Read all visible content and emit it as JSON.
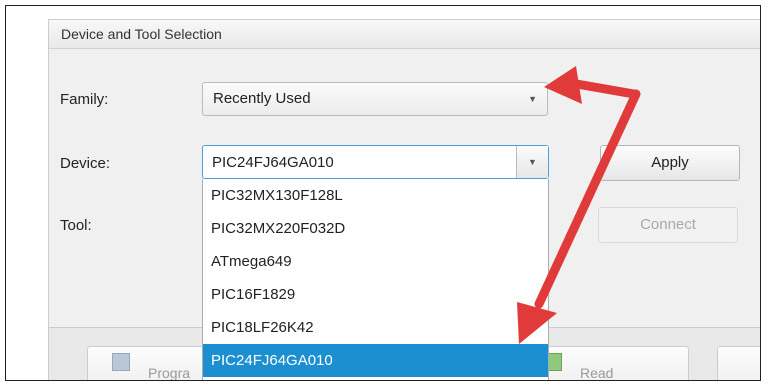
{
  "panel": {
    "title": "Device and Tool Selection"
  },
  "form": {
    "family_label": "Family:",
    "family_value": "Recently Used",
    "device_label": "Device:",
    "device_value": "PIC24FJ64GA010",
    "tool_label": "Tool:"
  },
  "buttons": {
    "apply": "Apply",
    "connect": "Connect",
    "program": "Progra",
    "read": "Read"
  },
  "dropdown": {
    "items": [
      "PIC32MX130F128L",
      "PIC32MX220F032D",
      "ATmega649",
      "PIC16F1829",
      "PIC18LF26K42",
      "PIC24FJ64GA010"
    ],
    "selected_index": 5
  },
  "colors": {
    "annotation_arrow": "#e03a3a",
    "selection": "#1c8fd0",
    "focus_border": "#4da0d8"
  },
  "icons": {
    "combo_caret": "chevron-down-icon",
    "program_button": "program-device-icon",
    "read_button": "read-device-icon"
  }
}
